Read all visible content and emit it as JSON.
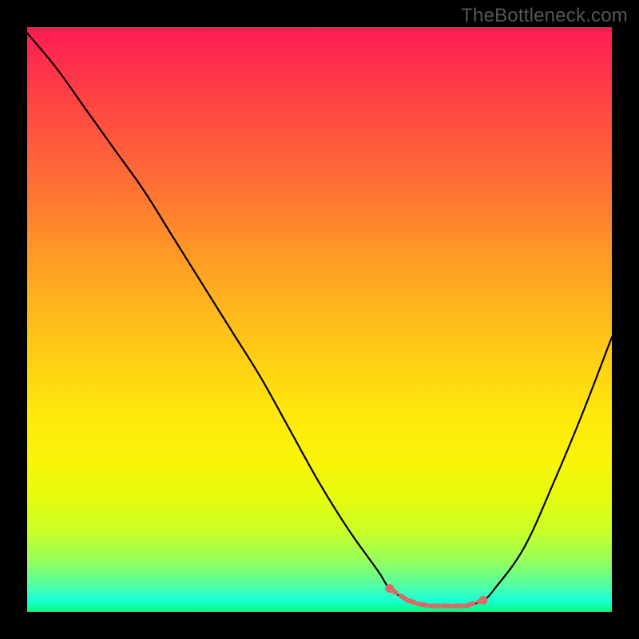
{
  "watermark": "TheBottleneck.com",
  "chart_data": {
    "type": "line",
    "title": "",
    "xlabel": "",
    "ylabel": "",
    "xlim": [
      0,
      100
    ],
    "ylim": [
      0,
      100
    ],
    "x": [
      0,
      5,
      10,
      15,
      20,
      25,
      30,
      35,
      40,
      45,
      50,
      55,
      60,
      62,
      65,
      68,
      70,
      72,
      75,
      78,
      80,
      85,
      90,
      95,
      100
    ],
    "values": [
      99,
      93,
      86,
      79,
      72,
      64,
      56,
      48,
      40,
      31,
      22,
      14,
      7,
      4,
      2,
      1,
      1,
      1,
      1,
      2,
      4,
      11,
      22,
      34,
      47
    ],
    "valley_markers_x": [
      62,
      65,
      67,
      69,
      71,
      73,
      75,
      78
    ],
    "marker_color": "#d96a6a",
    "curve_color": "#000000",
    "gradient_stops": [
      {
        "pos": 0,
        "color": "#ff1a53"
      },
      {
        "pos": 50,
        "color": "#ffd213"
      },
      {
        "pos": 80,
        "color": "#e8fb0c"
      },
      {
        "pos": 100,
        "color": "#00ff7a"
      }
    ]
  }
}
